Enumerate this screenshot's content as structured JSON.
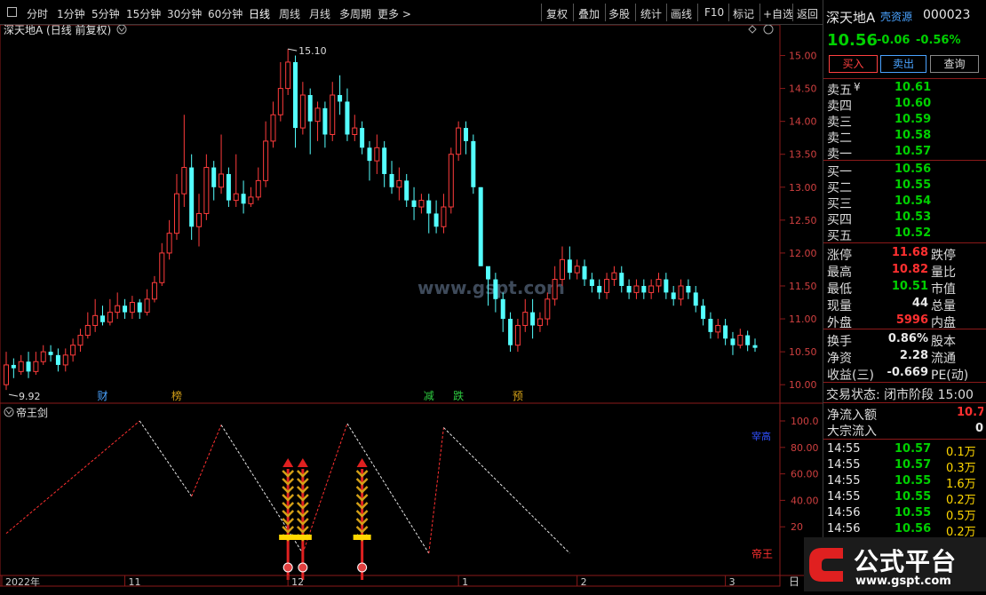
{
  "toolbar": {
    "periods": [
      "分时",
      "1分钟",
      "5分钟",
      "15分钟",
      "30分钟",
      "60分钟",
      "日线",
      "周线",
      "月线",
      "多周期",
      "更多 >"
    ],
    "actions": [
      "复权",
      "叠加",
      "多股",
      "统计",
      "画线",
      "F10",
      "标记",
      "+自选",
      "返回"
    ]
  },
  "chart": {
    "stock_title": "深天地A (日线 前复权)",
    "high_label": "15.10",
    "low_label": "9.92",
    "price_ticks": [
      "15.00",
      "14.50",
      "14.00",
      "13.50",
      "13.00",
      "12.50",
      "12.00",
      "11.50",
      "11.00",
      "10.50",
      "10.00"
    ],
    "event_tags": [
      {
        "text": "财",
        "color": "#4aa3ff"
      },
      {
        "text": "榜",
        "color": "#d4a017"
      },
      {
        "text": "减",
        "color": "#2ecc40"
      },
      {
        "text": "跌",
        "color": "#2ecc40"
      },
      {
        "text": "预",
        "color": "#d4a017"
      }
    ],
    "watermark": "www.gspt.com",
    "indicator_name": "帝王剑",
    "indicator_ticks": [
      "100.0",
      "80.00",
      "60.00",
      "40.00",
      "20"
    ],
    "indicator_labels": {
      "top": "宰高",
      "bottom": "帝王"
    },
    "date_labels": [
      "2022年",
      "11",
      "12",
      "1",
      "2",
      "3"
    ],
    "date_right": "日"
  },
  "chart_data": {
    "type": "candlestick",
    "price_range": [
      9.8,
      15.25
    ],
    "candles": [
      [
        10.0,
        10.3,
        10.5,
        9.92
      ],
      [
        10.3,
        10.25,
        10.4,
        10.1
      ],
      [
        10.2,
        10.35,
        10.45,
        10.15
      ],
      [
        10.35,
        10.2,
        10.5,
        10.1
      ],
      [
        10.2,
        10.35,
        10.5,
        10.15
      ],
      [
        10.35,
        10.5,
        10.6,
        10.3
      ],
      [
        10.5,
        10.45,
        10.6,
        10.35
      ],
      [
        10.45,
        10.3,
        10.55,
        10.2
      ],
      [
        10.3,
        10.45,
        10.55,
        10.2
      ],
      [
        10.45,
        10.6,
        10.7,
        10.35
      ],
      [
        10.6,
        10.75,
        10.85,
        10.5
      ],
      [
        10.75,
        10.9,
        11.1,
        10.7
      ],
      [
        10.9,
        11.05,
        11.3,
        10.8
      ],
      [
        11.05,
        10.95,
        11.2,
        10.9
      ],
      [
        10.95,
        11.1,
        11.3,
        10.9
      ],
      [
        11.1,
        11.2,
        11.4,
        11.0
      ],
      [
        11.2,
        11.1,
        11.3,
        11.0
      ],
      [
        11.1,
        11.25,
        11.35,
        11.0
      ],
      [
        11.25,
        11.1,
        11.3,
        11.0
      ],
      [
        11.1,
        11.3,
        11.45,
        11.05
      ],
      [
        11.3,
        11.55,
        11.65,
        11.25
      ],
      [
        11.55,
        12.0,
        12.15,
        11.5
      ],
      [
        12.0,
        12.3,
        12.5,
        11.9
      ],
      [
        12.3,
        12.9,
        13.2,
        12.2
      ],
      [
        12.9,
        13.3,
        14.1,
        12.7
      ],
      [
        13.3,
        12.4,
        13.5,
        12.2
      ],
      [
        12.4,
        12.6,
        12.9,
        12.1
      ],
      [
        12.6,
        13.3,
        13.5,
        12.5
      ],
      [
        13.3,
        13.0,
        13.4,
        12.8
      ],
      [
        13.0,
        13.2,
        13.8,
        12.9
      ],
      [
        13.2,
        12.8,
        13.3,
        12.7
      ],
      [
        12.8,
        12.9,
        13.5,
        12.7
      ],
      [
        12.9,
        12.75,
        13.1,
        12.6
      ],
      [
        12.75,
        12.85,
        13.0,
        12.7
      ],
      [
        12.85,
        13.1,
        13.3,
        12.8
      ],
      [
        13.1,
        13.7,
        14.0,
        13.0
      ],
      [
        13.7,
        14.1,
        14.3,
        13.6
      ],
      [
        14.1,
        14.5,
        14.9,
        14.0
      ],
      [
        14.5,
        14.9,
        15.1,
        14.4
      ],
      [
        14.9,
        13.9,
        15.0,
        13.6
      ],
      [
        13.9,
        14.4,
        14.6,
        13.8
      ],
      [
        14.4,
        14.0,
        14.5,
        13.5
      ],
      [
        14.0,
        14.2,
        14.3,
        13.7
      ],
      [
        14.2,
        13.8,
        14.3,
        13.6
      ],
      [
        13.8,
        14.4,
        14.6,
        13.7
      ],
      [
        14.4,
        14.3,
        14.7,
        14.1
      ],
      [
        14.3,
        13.8,
        14.5,
        13.7
      ],
      [
        13.8,
        13.9,
        14.1,
        13.7
      ],
      [
        13.9,
        13.6,
        14.0,
        13.5
      ],
      [
        13.6,
        13.4,
        13.7,
        13.1
      ],
      [
        13.4,
        13.6,
        13.8,
        13.2
      ],
      [
        13.6,
        13.2,
        13.7,
        13.0
      ],
      [
        13.2,
        13.0,
        13.4,
        12.9
      ],
      [
        13.0,
        13.1,
        13.3,
        12.8
      ],
      [
        13.1,
        12.8,
        13.2,
        12.7
      ],
      [
        12.8,
        12.7,
        13.0,
        12.5
      ],
      [
        12.7,
        12.8,
        12.9,
        12.6
      ],
      [
        12.8,
        12.6,
        12.9,
        12.3
      ],
      [
        12.6,
        12.4,
        12.8,
        12.3
      ],
      [
        12.4,
        12.7,
        12.9,
        12.3
      ],
      [
        12.7,
        13.5,
        13.6,
        12.6
      ],
      [
        13.5,
        13.9,
        14.0,
        13.4
      ],
      [
        13.9,
        13.7,
        14.0,
        13.5
      ],
      [
        13.7,
        13.0,
        13.8,
        12.9
      ],
      [
        13.0,
        11.8,
        13.0,
        11.8
      ],
      [
        11.8,
        11.6,
        11.7,
        11.2
      ],
      [
        11.6,
        11.3,
        11.7,
        11.1
      ],
      [
        11.3,
        11.0,
        11.4,
        10.8
      ],
      [
        11.0,
        10.6,
        11.1,
        10.5
      ],
      [
        10.6,
        10.9,
        11.0,
        10.5
      ],
      [
        10.9,
        11.1,
        11.3,
        10.8
      ],
      [
        11.1,
        10.9,
        11.3,
        10.7
      ],
      [
        10.9,
        11.0,
        11.1,
        10.8
      ],
      [
        11.0,
        11.3,
        11.4,
        10.9
      ],
      [
        11.3,
        11.6,
        11.8,
        11.2
      ],
      [
        11.6,
        11.9,
        12.1,
        11.5
      ],
      [
        11.9,
        11.7,
        12.1,
        11.6
      ],
      [
        11.7,
        11.8,
        11.9,
        11.6
      ],
      [
        11.8,
        11.6,
        11.9,
        11.5
      ],
      [
        11.6,
        11.5,
        11.7,
        11.4
      ],
      [
        11.5,
        11.4,
        11.6,
        11.3
      ],
      [
        11.4,
        11.6,
        11.7,
        11.3
      ],
      [
        11.6,
        11.7,
        11.8,
        11.5
      ],
      [
        11.7,
        11.5,
        11.8,
        11.4
      ],
      [
        11.5,
        11.4,
        11.6,
        11.3
      ],
      [
        11.4,
        11.5,
        11.6,
        11.3
      ],
      [
        11.5,
        11.4,
        11.6,
        11.3
      ],
      [
        11.4,
        11.5,
        11.6,
        11.3
      ],
      [
        11.5,
        11.6,
        11.7,
        11.4
      ],
      [
        11.6,
        11.4,
        11.7,
        11.3
      ],
      [
        11.4,
        11.3,
        11.5,
        11.2
      ],
      [
        11.3,
        11.5,
        11.6,
        11.2
      ],
      [
        11.5,
        11.4,
        11.6,
        11.3
      ],
      [
        11.4,
        11.2,
        11.5,
        11.1
      ],
      [
        11.2,
        11.0,
        11.3,
        10.9
      ],
      [
        11.0,
        10.8,
        11.1,
        10.7
      ],
      [
        10.8,
        10.9,
        11.0,
        10.7
      ],
      [
        10.9,
        10.7,
        11.0,
        10.6
      ],
      [
        10.7,
        10.6,
        10.8,
        10.45
      ],
      [
        10.6,
        10.75,
        10.85,
        10.55
      ],
      [
        10.75,
        10.6,
        10.82,
        10.51
      ],
      [
        10.6,
        10.56,
        10.7,
        10.5
      ]
    ],
    "indicator_range": [
      0,
      100
    ],
    "indicator_line": [
      [
        0,
        15
      ],
      [
        18,
        100
      ],
      [
        25,
        43
      ],
      [
        29,
        97
      ],
      [
        40,
        0
      ],
      [
        46,
        98
      ],
      [
        57,
        0
      ],
      [
        59,
        95
      ],
      [
        76,
        0
      ]
    ],
    "signals": [
      38,
      40,
      48
    ]
  },
  "right": {
    "name": "深天地A",
    "tag": "壳资源",
    "code": "000023",
    "price": "10.56",
    "change": "-0.06",
    "change_pct": "-0.56%",
    "buttons": [
      "买入",
      "卖出",
      "查询"
    ],
    "asks": [
      {
        "label": "卖五",
        "val": "10.61",
        "suffix": "¥"
      },
      {
        "label": "卖四",
        "val": "10.60"
      },
      {
        "label": "卖三",
        "val": "10.59"
      },
      {
        "label": "卖二",
        "val": "10.58"
      },
      {
        "label": "卖一",
        "val": "10.57"
      }
    ],
    "bids": [
      {
        "label": "买一",
        "val": "10.56"
      },
      {
        "label": "买二",
        "val": "10.55"
      },
      {
        "label": "买三",
        "val": "10.54"
      },
      {
        "label": "买四",
        "val": "10.53"
      },
      {
        "label": "买五",
        "val": "10.52"
      }
    ],
    "stats1": [
      {
        "l1": "涨停",
        "v1": "11.68",
        "c1": "red",
        "l2": "跌停"
      },
      {
        "l1": "最高",
        "v1": "10.82",
        "c1": "red",
        "l2": "量比"
      },
      {
        "l1": "最低",
        "v1": "10.51",
        "c1": "green",
        "l2": "市值"
      },
      {
        "l1": "现量",
        "v1": "44",
        "c1": "white",
        "l2": "总量"
      },
      {
        "l1": "外盘",
        "v1": "5996",
        "c1": "red",
        "l2": "内盘"
      }
    ],
    "stats2": [
      {
        "l1": "换手",
        "v1": "0.86%",
        "l2": "股本"
      },
      {
        "l1": "净资",
        "v1": "2.28",
        "l2": "流通"
      },
      {
        "l1": "收益(三)",
        "v1": "-0.669",
        "l2": "PE(动)"
      }
    ],
    "trade_status": "交易状态: 闭市阶段 15:00",
    "flow": [
      {
        "label": "净流入额",
        "val": "10.7"
      },
      {
        "label": "大宗流入",
        "val": "0"
      }
    ],
    "ticks": [
      {
        "time": "14:55",
        "price": "10.57",
        "vol": "0.1万"
      },
      {
        "time": "14:55",
        "price": "10.57",
        "vol": "0.3万"
      },
      {
        "time": "14:55",
        "price": "10.55",
        "vol": "1.6万"
      },
      {
        "time": "14:55",
        "price": "10.55",
        "vol": "0.2万"
      },
      {
        "time": "14:56",
        "price": "10.55",
        "vol": "0.5万"
      },
      {
        "time": "14:56",
        "price": "10.56",
        "vol": "0.2万"
      }
    ],
    "logo_text": "公式平台",
    "logo_url": "www.gspt.com"
  }
}
